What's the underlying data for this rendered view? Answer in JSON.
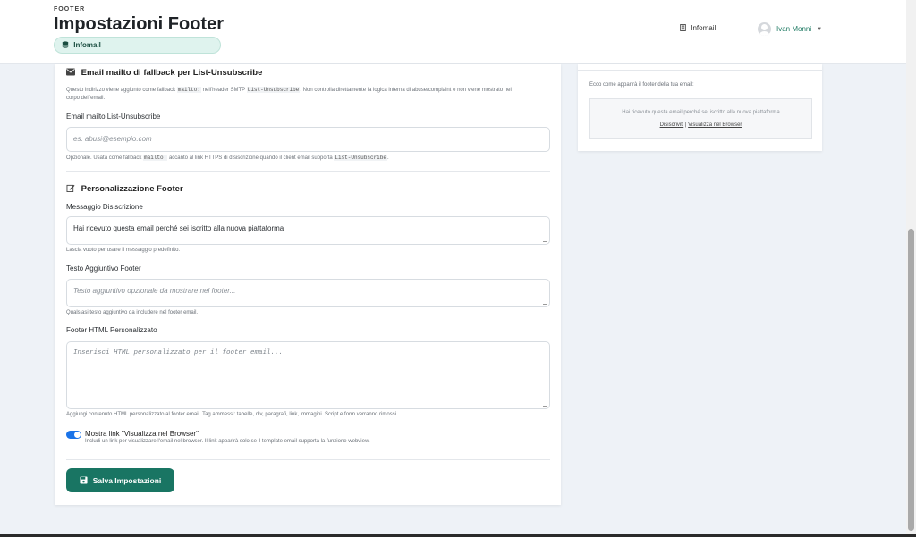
{
  "header": {
    "pretitle": "FOOTER",
    "title": "Impostazioni Footer",
    "badge": "Infomail",
    "tenant": "Infomail",
    "user": "Ivan Monni"
  },
  "fallback_section": {
    "title": "Email mailto di fallback per List-Unsubscribe",
    "help_1": "Questo indirizzo viene aggiunto come fallback",
    "help_code_1": "mailto:",
    "help_2": "nell'header SMTP",
    "help_code_2": "List-Unsubscribe",
    "help_3": ". Non controlla direttamente la logica interna di abuse/complaint e non viene mostrato nel",
    "help_4": "corpo dell'email.",
    "field_label": "Email mailto List-Unsubscribe",
    "field_placeholder": "es. abusi@esempio.com",
    "field_help_1": "Opzionale. Usata come fallback",
    "field_help_code_1": "mailto:",
    "field_help_2": "accanto al link HTTPS di disiscrizione quando il client email supporta",
    "field_help_code_2": "List-Unsubscribe",
    "field_help_3": "."
  },
  "footer_section": {
    "title": "Personalizzazione Footer",
    "unsub_label": "Messaggio Disiscrizione",
    "unsub_value": "Hai ricevuto questa email perché sei iscritto alla nuova piattaforma",
    "unsub_help": "Lascia vuoto per usare il messaggio predefinito.",
    "extra_label": "Testo Aggiuntivo Footer",
    "extra_placeholder": "Testo aggiuntivo opzionale da mostrare nel footer...",
    "extra_help": "Qualsiasi testo aggiuntivo da includere nel footer email.",
    "html_label": "Footer HTML Personalizzato",
    "html_placeholder": "Inserisci HTML personalizzato per il footer email...",
    "html_help": "Aggiungi contenuto HTML personalizzato al footer email. Tag ammessi: tabelle, div, paragrafi, link, immagini. Script e form verranno rimossi.",
    "toggle_label": "Mostra link \"Visualizza nel Browser\"",
    "toggle_help": "Includi un link per visualizzare l'email nel browser. Il link apparirà solo se il template email supporta la funzione webview.",
    "toggle_on": true,
    "save_label": "Salva Impostazioni"
  },
  "preview": {
    "help": "Ecco come apparirà il footer della tua email:",
    "message": "Hai ricevuto questa email perché sei iscritto alla nuova piattaforma",
    "link_unsubscribe": "Disiscriviti",
    "separator": "|",
    "link_browser": "Visualizza nel Browser"
  },
  "colors": {
    "accent": "#197563",
    "toggle": "#1a73e8",
    "badge_bg": "#dff3ee"
  }
}
